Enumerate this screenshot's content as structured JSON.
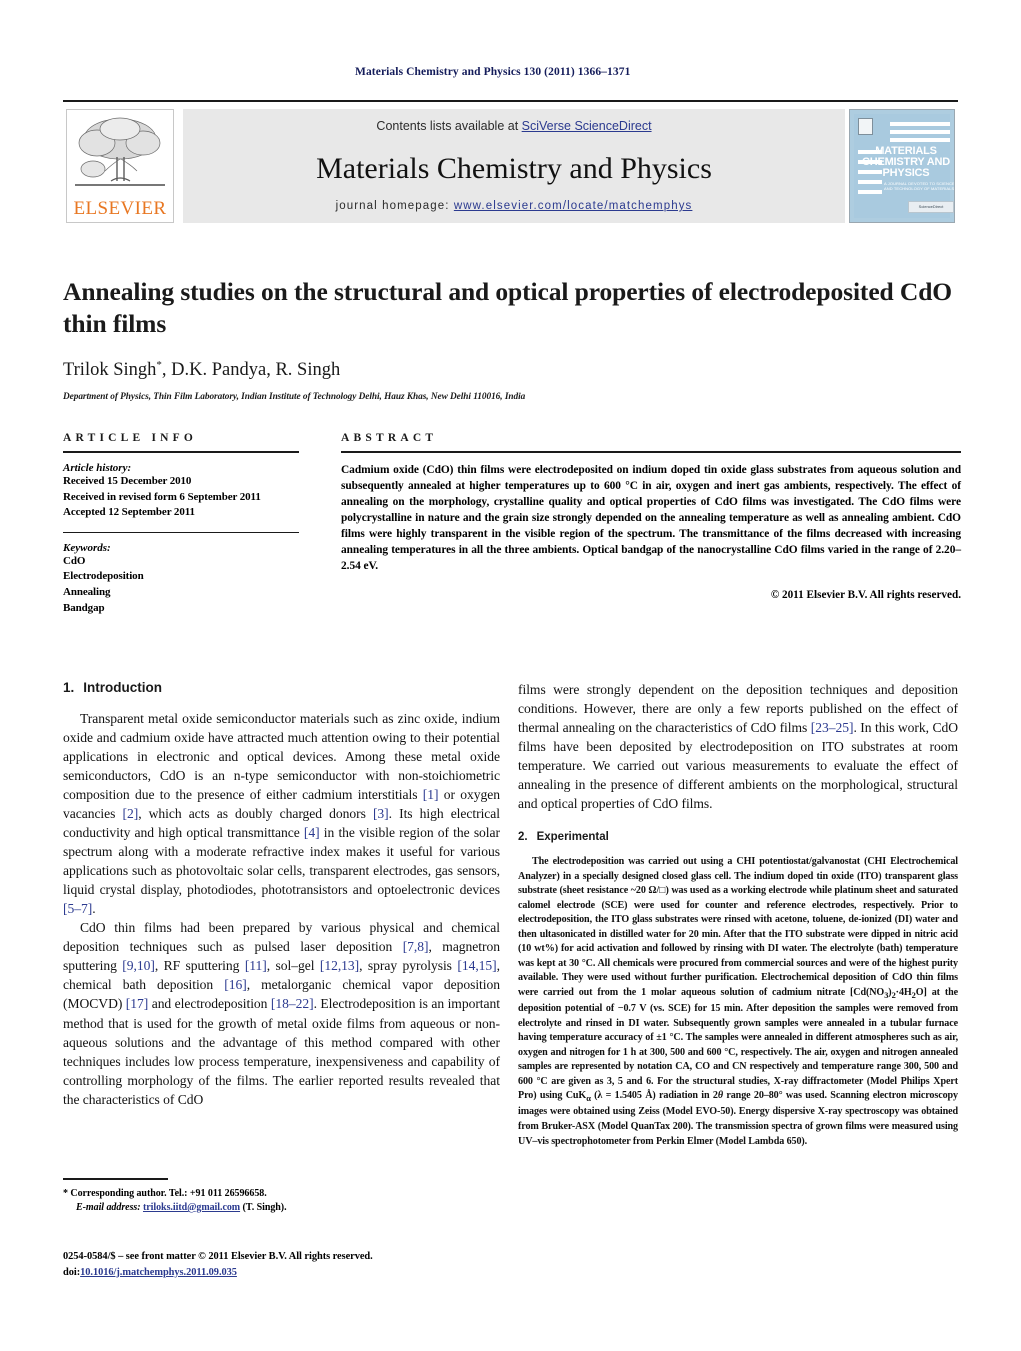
{
  "running_head": "Materials Chemistry and Physics 130 (2011) 1366–1371",
  "banner": {
    "contents_prefix": "Contents lists available at ",
    "contents_link": "SciVerse ScienceDirect",
    "journal_title": "Materials Chemistry and Physics",
    "homepage_prefix": "journal homepage: ",
    "homepage_url": "www.elsevier.com/locate/matchemphys",
    "publisher_logo_text": "ELSEVIER",
    "cover": {
      "title_line1": "MATERIALS",
      "title_line2": "CHEMISTRY AND",
      "title_line3": "PHYSICS",
      "subtitle": "A JOURNAL DEVOTED TO SCIENCE AND TECHNOLOGY OF MATERIALS",
      "footer": "ScienceDirect"
    },
    "link_color": "#2b3a8f",
    "logo_color": "#e87722",
    "cover_bg_color": "#a9cadf"
  },
  "article": {
    "title": "Annealing studies on the structural and optical properties of electrodeposited CdO thin films",
    "authors": "Trilok Singh, D.K. Pandya, R. Singh",
    "author_marker": "*",
    "affiliation": "Department of Physics, Thin Film Laboratory, Indian Institute of Technology Delhi, Hauz Khas, New Delhi 110016, India"
  },
  "article_info": {
    "heading": "ARTICLE INFO",
    "history_label": "Article history:",
    "history": [
      "Received 15 December 2010",
      "Received in revised form 6 September 2011",
      "Accepted 12 September 2011"
    ],
    "keywords_label": "Keywords:",
    "keywords": [
      "CdO",
      "Electrodeposition",
      "Annealing",
      "Bandgap"
    ]
  },
  "abstract": {
    "heading": "ABSTRACT",
    "text": "Cadmium oxide (CdO) thin films were electrodeposited on indium doped tin oxide glass substrates from aqueous solution and subsequently annealed at higher temperatures up to 600 °C in air, oxygen and inert gas ambients, respectively. The effect of annealing on the morphology, crystalline quality and optical properties of CdO films was investigated. The CdO films were polycrystalline in nature and the grain size strongly depended on the annealing temperature as well as annealing ambient. CdO films were highly transparent in the visible region of the spectrum. The transmittance of the films decreased with increasing annealing temperatures in all the three ambients. Optical bandgap of the nanocrystalline CdO films varied in the range of 2.20–2.54 eV.",
    "copyright": "© 2011 Elsevier B.V. All rights reserved."
  },
  "sections": {
    "introduction": {
      "number": "1.",
      "title": "Introduction",
      "paragraph_1": "Transparent metal oxide semiconductor materials such as zinc oxide, indium oxide and cadmium oxide have attracted much attention owing to their potential applications in electronic and optical devices. Among these metal oxide semiconductors, CdO is an n-type semiconductor with non-stoichiometric composition due to the presence of either cadmium interstitials [1] or oxygen vacancies [2], which acts as doubly charged donors [3]. Its high electrical conductivity and high optical transmittance [4] in the visible region of the solar spectrum along with a moderate refractive index makes it useful for various applications such as photovoltaic solar cells, transparent electrodes, gas sensors, liquid crystal display, photodiodes, phototransistors and optoelectronic devices [5–7].",
      "paragraph_2": "CdO thin films had been prepared by various physical and chemical deposition techniques such as pulsed laser deposition [7,8], magnetron sputtering [9,10], RF sputtering [11], sol–gel [12,13], spray pyrolysis [14,15], chemical bath deposition [16], metalorganic chemical vapor deposition (MOCVD) [17] and electrodeposition [18–22]. Electrodeposition is an important method that is used for the growth of metal oxide films from aqueous or non-aqueous solutions and the advantage of this method compared with other techniques includes low process temperature, inexpensiveness and capability of controlling morphology of the films. The earlier reported results revealed that the characteristics of CdO",
      "paragraph_2_cont": "films were strongly dependent on the deposition techniques and deposition conditions. However, there are only a few reports published on the effect of thermal annealing on the characteristics of CdO films [23–25]. In this work, CdO films have been deposited by electrodeposition on ITO substrates at room temperature. We carried out various measurements to evaluate the effect of annealing in the presence of different ambients on the morphological, structural and optical properties of CdO films."
    },
    "experimental": {
      "number": "2.",
      "title": "Experimental",
      "paragraph_1": "The electrodeposition was carried out using a CHI potentiostat/galvanostat (CHI Electrochemical Analyzer) in a specially designed closed glass cell. The indium doped tin oxide (ITO) transparent glass substrate (sheet resistance ~20 Ω/□) was used as a working electrode while platinum sheet and saturated calomel electrode (SCE) were used for counter and reference electrodes, respectively. Prior to electrodeposition, the ITO glass substrates were rinsed with acetone, toluene, de-ionized (DI) water and then ultasonicated in distilled water for 20 min. After that the ITO substrate were dipped in nitric acid (10 wt%) for acid activation and followed by rinsing with DI water. The electrolyte (bath) temperature was kept at 30 °C. All chemicals were procured from commercial sources and were of the highest purity available. They were used without further purification. Electrochemical deposition of CdO thin films were carried out from the 1 molar aqueous solution of cadmium nitrate [Cd(NO3)2·4H2O] at the deposition potential of −0.7 V (vs. SCE) for 15 min. After deposition the samples were removed from electrolyte and rinsed in DI water. Subsequently grown samples were annealed in a tubular furnace having temperature accuracy of ±1 °C. The samples were annealed in different atmospheres such as air, oxygen and nitrogen for 1 h at 300, 500 and 600 °C, respectively. The air, oxygen and nitrogen annealed samples are represented by notation CA, CO and CN respectively and temperature range 300, 500 and 600 °C are given as 3, 5 and 6. For the structural studies, X-ray diffractometer (Model Philips Xpert Pro) using CuKα (λ = 1.5405 Å) radiation in 2θ range 20–80° was used. Scanning electron microscopy images were obtained using Zeiss (Model EVO-50). Energy dispersive X-ray spectroscopy was obtained from Bruker-ASX (Model QuanTax 200). The transmission spectra of grown films were measured using UV–vis spectrophotometer from Perkin Elmer (Model Lambda 650)."
    }
  },
  "footnote": {
    "marker": "*",
    "corresponding": "Corresponding author. Tel.: +91 011 26596658.",
    "email_label": "E-mail address:",
    "email": "triloks.iitd@gmail.com",
    "email_suffix": "(T. Singh)."
  },
  "imprint": {
    "line1": "0254-0584/$ – see front matter © 2011 Elsevier B.V. All rights reserved.",
    "doi_label": "doi:",
    "doi": "10.1016/j.matchemphys.2011.09.035"
  }
}
